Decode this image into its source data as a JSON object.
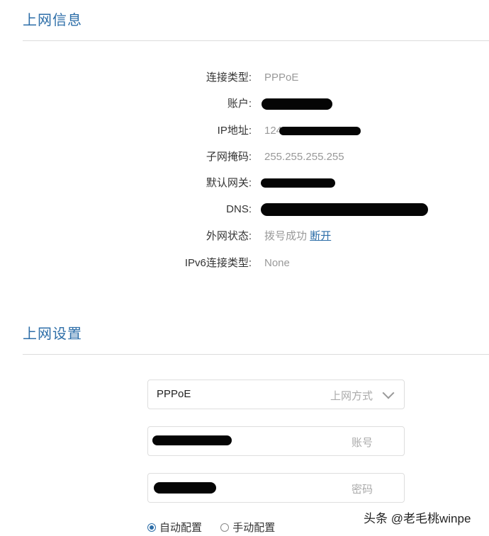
{
  "info_section": {
    "title": "上网信息",
    "rows": [
      {
        "label": "连接类型:",
        "value": "PPPoE"
      },
      {
        "label": "账户:",
        "value": ""
      },
      {
        "label": "IP地址:",
        "value": "124"
      },
      {
        "label": "子网掩码:",
        "value": "255.255.255.255"
      },
      {
        "label": "默认网关:",
        "value": ""
      },
      {
        "label": "DNS:",
        "value": ""
      },
      {
        "label": "外网状态:",
        "value": "拨号成功",
        "link": "断开"
      },
      {
        "label": "IPv6连接类型:",
        "value": "None"
      }
    ]
  },
  "settings_section": {
    "title": "上网设置",
    "method_field": {
      "value": "PPPoE",
      "hint": "上网方式"
    },
    "account_field": {
      "hint": "账号"
    },
    "password_field": {
      "hint": "密码"
    },
    "radio_options": [
      {
        "label": "自动配置",
        "checked": true
      },
      {
        "label": "手动配置",
        "checked": false
      }
    ]
  },
  "watermark": "头条 @老毛桃winpe",
  "colors": {
    "accent": "#2d6ea8",
    "redaction": "#050505"
  }
}
